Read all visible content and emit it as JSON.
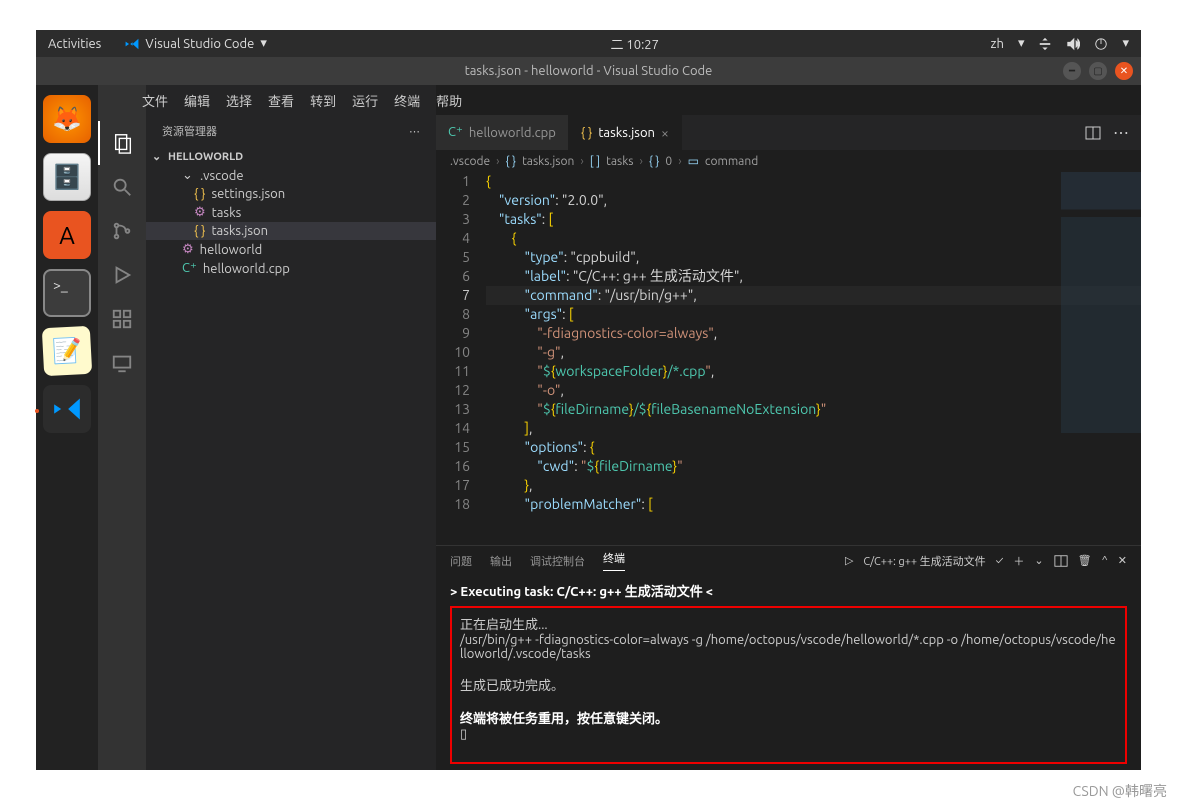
{
  "gnome": {
    "activities": "Activities",
    "app": "Visual Studio Code",
    "clock": "二 10:27",
    "lang": "zh"
  },
  "titlebar": {
    "text": "tasks.json - helloworld - Visual Studio Code"
  },
  "menu": [
    "文件",
    "编辑",
    "选择",
    "查看",
    "转到",
    "运行",
    "终端",
    "帮助"
  ],
  "sidebar": {
    "title": "资源管理器",
    "root": "HELLOWORLD",
    "items": [
      {
        "type": "folder",
        "label": ".vscode",
        "icon": "chevron"
      },
      {
        "type": "file",
        "label": "settings.json",
        "icon": "json"
      },
      {
        "type": "file",
        "label": "tasks",
        "icon": "gear"
      },
      {
        "type": "file",
        "label": "tasks.json",
        "icon": "json",
        "selected": true
      },
      {
        "type": "file",
        "label": "helloworld",
        "icon": "gear",
        "indent": 1
      },
      {
        "type": "file",
        "label": "helloworld.cpp",
        "icon": "cpp",
        "indent": 1
      }
    ]
  },
  "tabs": [
    {
      "label": "helloworld.cpp",
      "icon": "cpp",
      "active": false
    },
    {
      "label": "tasks.json",
      "icon": "json",
      "active": true
    }
  ],
  "breadcrumb": [
    ".vscode",
    "tasks.json",
    "tasks",
    "0",
    "command"
  ],
  "breadcrumb_icons": [
    "",
    "{ }",
    "[ ]",
    "{ }",
    "▭"
  ],
  "code": {
    "lines": [
      "{",
      "    \"version\": \"2.0.0\",",
      "    \"tasks\": [",
      "        {",
      "            \"type\": \"cppbuild\",",
      "            \"label\": \"C/C++: g++ 生成活动文件\",",
      "            \"command\": \"/usr/bin/g++\",",
      "            \"args\": [",
      "                \"-fdiagnostics-color=always\",",
      "                \"-g\",",
      "                \"${workspaceFolder}/*.cpp\",",
      "                \"-o\",",
      "                \"${fileDirname}/${fileBasenameNoExtension}\"",
      "            ],",
      "            \"options\": {",
      "                \"cwd\": \"${fileDirname}\"",
      "            },",
      "            \"problemMatcher\": ["
    ],
    "current_line": 7
  },
  "panel": {
    "tabs": [
      "问题",
      "输出",
      "调试控制台",
      "终端"
    ],
    "active_tab": "终端",
    "task_label": "C/C++: g++ 生成活动文件",
    "terminal": {
      "exec_line": "> Executing task: C/C++: g++ 生成活动文件 <",
      "start": "正在启动生成...",
      "cmd": "/usr/bin/g++ -fdiagnostics-color=always -g /home/octopus/vscode/helloworld/*.cpp -o /home/octopus/vscode/helloworld/.vscode/tasks",
      "done": "生成已成功完成。",
      "reuse": "终端将被任务重用，按任意键关闭。",
      "cursor": "▯"
    }
  },
  "watermark": "CSDN @韩曙亮"
}
